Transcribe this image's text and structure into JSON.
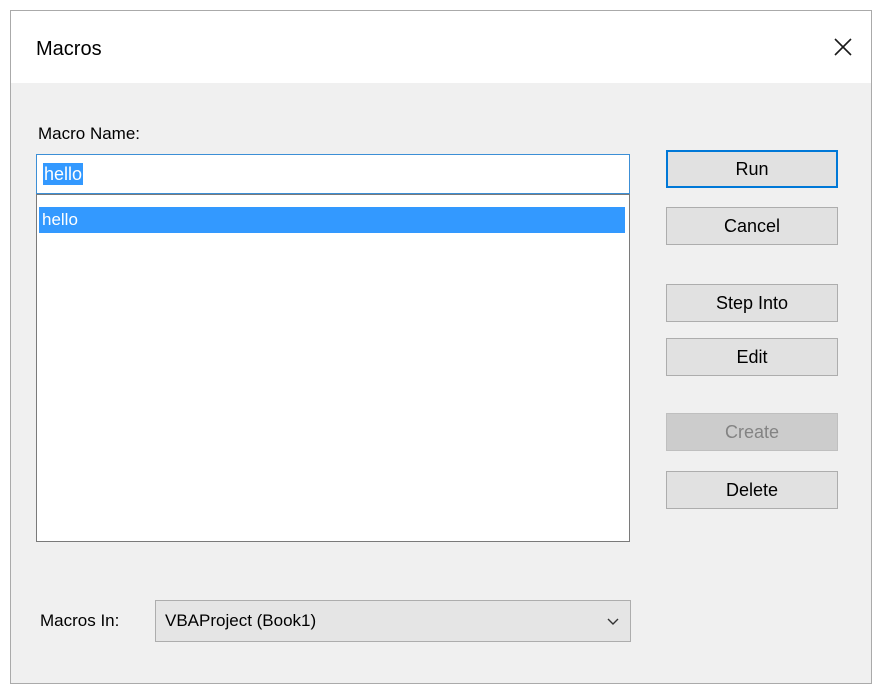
{
  "window": {
    "title": "Macros"
  },
  "form": {
    "macro_name_label": "Macro Name:",
    "macro_name_value": "hello",
    "macro_list": [
      "hello"
    ],
    "macros_in_label": "Macros In:",
    "macros_in_value": "VBAProject (Book1)"
  },
  "buttons": {
    "run": "Run",
    "cancel": "Cancel",
    "step_into": "Step Into",
    "edit": "Edit",
    "create": "Create",
    "delete": "Delete"
  },
  "colors": {
    "selection": "#3399ff",
    "focus_border": "#0078d7",
    "dialog_bg": "#f0f0f0"
  },
  "icons": {
    "close": "close-icon",
    "dropdown": "chevron-down-icon"
  }
}
